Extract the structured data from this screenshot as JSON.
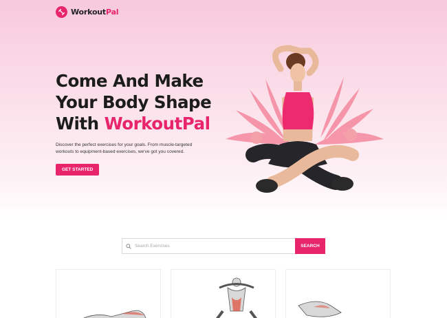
{
  "brand": {
    "name_main": "Workout",
    "name_accent": "Pal",
    "accent_color": "#e8246a",
    "logo_icon": "dumbbell-icon"
  },
  "hero": {
    "title_line1": "Come And Make",
    "title_line2": "Your Body Shape",
    "title_line3_prefix": "With ",
    "title_line3_accent": "WorkoutPal",
    "description": "Discover the perfect exercises for your goals. From muscle-targeted workouts to equipment-based exercises, we've got you covered.",
    "cta_label": "GET STARTED",
    "image": "woman-sitting-stretching"
  },
  "search": {
    "placeholder": "Search Exercises",
    "value": "",
    "button_label": "SEARCH",
    "icon": "search-icon"
  },
  "exercises": [
    {
      "image": "exercise-illustration-lying-legs"
    },
    {
      "image": "exercise-illustration-crunch"
    },
    {
      "image": "exercise-illustration-leg-raise"
    }
  ]
}
